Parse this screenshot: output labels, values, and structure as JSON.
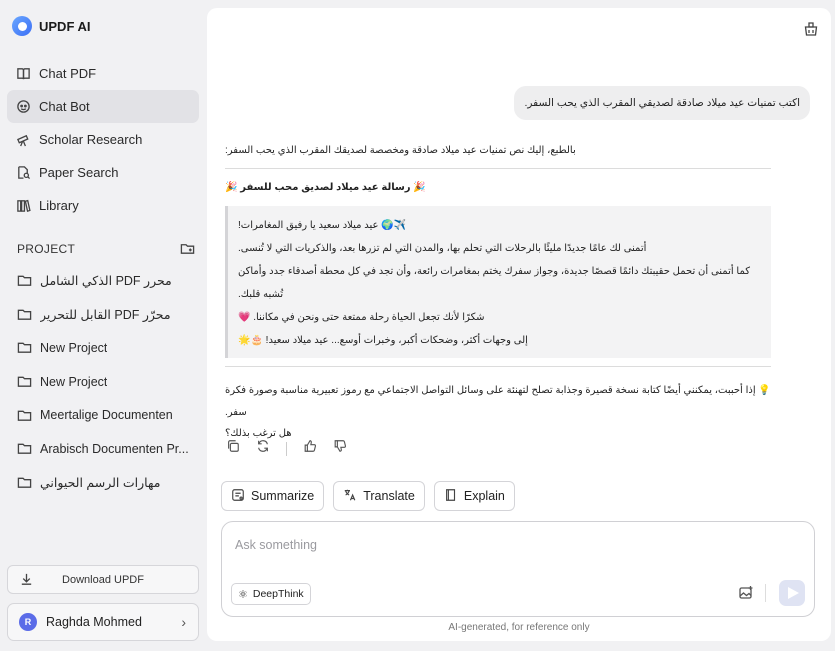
{
  "app": {
    "name": "UPDF AI"
  },
  "nav": [
    {
      "label": "Chat PDF",
      "icon": "book-open-icon",
      "active": false
    },
    {
      "label": "Chat Bot",
      "icon": "chatbot-icon",
      "active": true
    },
    {
      "label": "Scholar Research",
      "icon": "telescope-icon",
      "active": false
    },
    {
      "label": "Paper Search",
      "icon": "document-search-icon",
      "active": false
    },
    {
      "label": "Library",
      "icon": "library-icon",
      "active": false
    }
  ],
  "project": {
    "heading": "PROJECT",
    "items": [
      "الذكي الشامل PDF محرر",
      "القابل للتحرير PDF محرّر",
      "New Project",
      "New Project",
      "Meertalige Documenten",
      "Arabisch Documenten Pr...",
      "مهارات الرسم الحيواني"
    ]
  },
  "download_label": "Download UPDF",
  "user": {
    "initial": "R",
    "name": "Raghda Mohmed"
  },
  "chat": {
    "user_message": "اكتب تمنيات عيد ميلاد صادقة لصديقي المقرب الذي يحب السفر.",
    "intro": "بالطبع، إليك نص تمنيات عيد ميلاد صادقة ومخصصة لصديقك المقرب الذي يحب السفر:",
    "heading": "🎉 رسالة عيد ميلاد لصديق محب للسفر 🎉",
    "quote_lines": [
      "✈️🌍 عيد ميلاد سعيد يا رفيق المغامرات!",
      "أتمنى لك عامًا جديدًا مليئًا بالرحلات التي تحلم بها، والمدن التي لم تزرها بعد، والذكريات التي لا تُنسى.",
      "كما أتمنى أن تحمل حقيبتك دائمًا قصصًا جديدة، وجواز سفرك يختم بمغامرات رائعة، وأن تجد في كل محطة أصدقاء جدد وأماكن تُشبه قلبك.",
      "شكرًا لأنك تجعل الحياة رحلة ممتعة حتى ونحن في مكاننا. 💗",
      "إلى وجهات أكثر، وضحكات أكبر، وخبرات أوسع... عيد ميلاد سعيد! 🎂🌟"
    ],
    "outro_line1": "💡 إذا أحببت، يمكنني أيضًا كتابة نسخة قصيرة وجذابة تصلح لتهنئة على وسائل التواصل الاجتماعي مع رموز تعبيرية مناسبة وصورة فكرة سفر.",
    "outro_line2": "هل ترغب بذلك؟"
  },
  "tools": [
    {
      "label": "Summarize",
      "icon": "summarize-icon"
    },
    {
      "label": "Translate",
      "icon": "translate-icon"
    },
    {
      "label": "Explain",
      "icon": "explain-book-icon"
    }
  ],
  "input": {
    "placeholder": "Ask something",
    "value": ""
  },
  "deepthink_label": "DeepThink",
  "footer_note": "AI-generated, for reference only"
}
